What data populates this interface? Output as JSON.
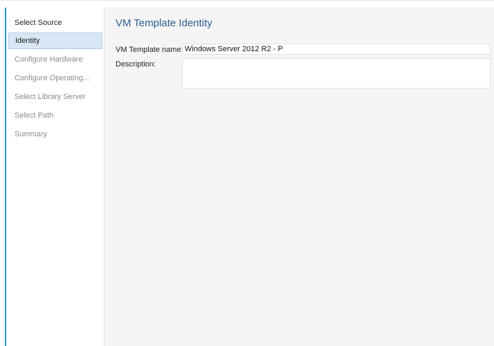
{
  "sidebar": {
    "items": [
      {
        "label": "Select Source",
        "state": "completed"
      },
      {
        "label": "Identity",
        "state": "active"
      },
      {
        "label": "Configure Hardware",
        "state": "pending"
      },
      {
        "label": "Configure Operating...",
        "state": "pending"
      },
      {
        "label": "Select Library Server",
        "state": "pending"
      },
      {
        "label": "Select Path",
        "state": "pending"
      },
      {
        "label": "Summary",
        "state": "pending"
      }
    ]
  },
  "main": {
    "title": "VM Template Identity",
    "template_name": {
      "label": "VM Template name:",
      "value": "Windows Server 2012 R2 - P"
    },
    "description": {
      "label": "Description:",
      "value": ""
    }
  },
  "colors": {
    "accent": "#2e8dc8",
    "title": "#2c5a8f",
    "active_item_bg": "#d9e6f5",
    "pending_text": "#8a8a8a"
  }
}
